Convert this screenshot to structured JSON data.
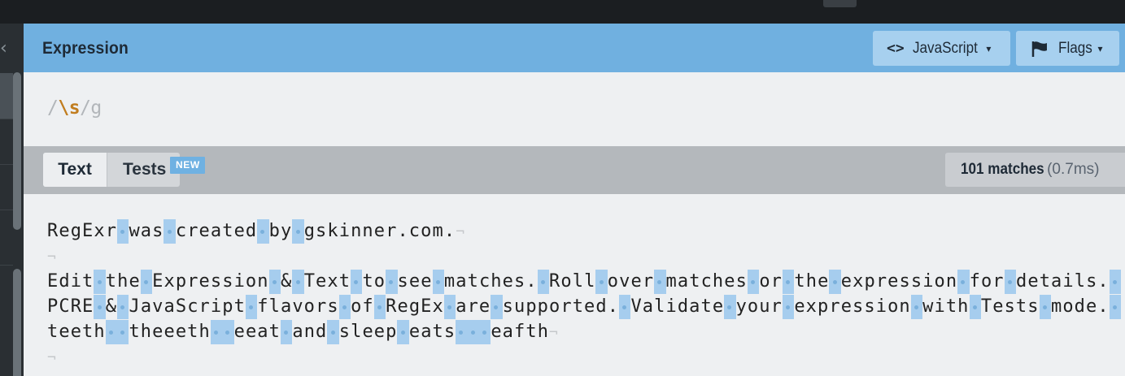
{
  "topbar": {},
  "expression_panel": {
    "title": "Expression",
    "flavor_button": {
      "icon": "code-brackets-icon",
      "label": "JavaScript",
      "caret": "▾"
    },
    "flags_button": {
      "icon": "flag-icon",
      "label": "Flags",
      "caret": "▾"
    },
    "expression": {
      "open_delim": "/",
      "pattern": "\\s",
      "close_delim": "/",
      "flags": "g"
    }
  },
  "text_panel": {
    "tabs": [
      {
        "label": "Text",
        "active": true
      },
      {
        "label": "Tests",
        "active": false
      }
    ],
    "new_badge": "NEW",
    "match_count": "101 matches",
    "match_time": "(0.7ms)",
    "lines": [
      "RegExr was created by gskinner.com.",
      "",
      "Edit the Expression & Text to see matches. Roll over matches or the expression for details. ",
      "PCRE & JavaScript flavors of RegEx are supported. Validate your expression with Tests mode. ",
      "teeth  theeeth  eeat and sleep eats   eafth",
      ""
    ],
    "line_end_marker": "¬"
  },
  "colors": {
    "header_blue": "#70b0e0",
    "match_highlight": "#a6cdee",
    "escape_orange": "#c17d1f"
  }
}
